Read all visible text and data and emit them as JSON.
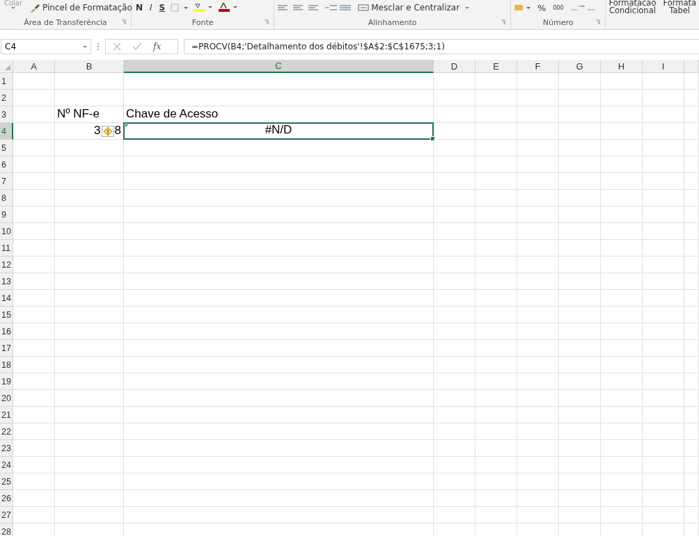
{
  "ribbon": {
    "groups": [
      {
        "kind": "clipboard",
        "label": "Área de Transferência",
        "items": [
          {
            "label": "Colar"
          },
          {
            "label": "Pincel de Formatação"
          }
        ]
      },
      {
        "kind": "font",
        "label": "Fonte",
        "items": [
          {
            "label": "N"
          },
          {
            "label": "I"
          },
          {
            "label": "S"
          }
        ]
      },
      {
        "kind": "alignment",
        "label": "Alinhamento",
        "items": [
          {
            "label": "Mesclar e Centralizar"
          }
        ]
      },
      {
        "kind": "number",
        "label": "Número",
        "items": [
          {
            "label": "%"
          },
          {
            "label": "000"
          }
        ]
      },
      {
        "kind": "styles",
        "items": [
          {
            "label": "Formatação",
            "label2": "Condicional"
          },
          {
            "label": "Formata",
            "label2": "Tabel"
          }
        ]
      }
    ]
  },
  "name_box": "C4",
  "function_button": "fx",
  "formula": "=PROCV(B4;'Detalhamento dos débitos'!$A$2:$C$1675;3;1)",
  "columns": [
    {
      "label": "A",
      "selected": false
    },
    {
      "label": "B",
      "selected": false
    },
    {
      "label": "C",
      "selected": true
    },
    {
      "label": "D",
      "selected": false
    },
    {
      "label": "E",
      "selected": false
    },
    {
      "label": "F",
      "selected": false
    },
    {
      "label": "G",
      "selected": false
    },
    {
      "label": "H",
      "selected": false
    },
    {
      "label": "I",
      "selected": false
    }
  ],
  "rows": [
    {
      "header": "1",
      "selected": false
    },
    {
      "header": "2",
      "selected": false
    },
    {
      "header": "3",
      "selected": false,
      "cells": {
        "B": {
          "kind": "text",
          "text": "Nº NF-e"
        },
        "C": {
          "kind": "text",
          "text": "Chave de Acesso"
        }
      }
    },
    {
      "header": "4",
      "selected": true,
      "cells": {
        "B": {
          "kind": "number",
          "text": "3",
          "text_after": "8",
          "warning": true
        },
        "C": {
          "kind": "error",
          "text": "#N/D",
          "selected": true,
          "error_mark": true
        }
      }
    },
    {
      "header": "5",
      "selected": false
    },
    {
      "header": "6",
      "selected": false
    },
    {
      "header": "7",
      "selected": false
    },
    {
      "header": "8",
      "selected": false
    },
    {
      "header": "9",
      "selected": false
    },
    {
      "header": "10",
      "selected": false
    },
    {
      "header": "11",
      "selected": false
    },
    {
      "header": "12",
      "selected": false
    },
    {
      "header": "13",
      "selected": false
    },
    {
      "header": "14",
      "selected": false
    },
    {
      "header": "15",
      "selected": false
    },
    {
      "header": "16",
      "selected": false
    },
    {
      "header": "17",
      "selected": false
    },
    {
      "header": "18",
      "selected": false
    },
    {
      "header": "19",
      "selected": false
    },
    {
      "header": "20",
      "selected": false
    },
    {
      "header": "21",
      "selected": false
    },
    {
      "header": "22",
      "selected": false
    },
    {
      "header": "23",
      "selected": false
    },
    {
      "header": "24",
      "selected": false
    },
    {
      "header": "25",
      "selected": false
    },
    {
      "header": "26",
      "selected": false
    },
    {
      "header": "27",
      "selected": false
    },
    {
      "header": "28",
      "selected": false
    }
  ]
}
